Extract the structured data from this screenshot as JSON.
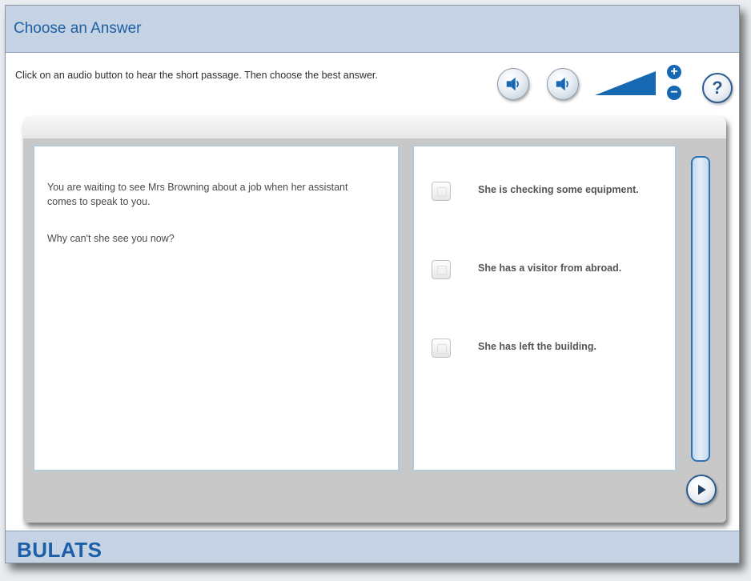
{
  "header": {
    "title": "Choose an Answer"
  },
  "toolbar": {
    "instruction": "Click on an audio button to hear the short passage. Then choose the best answer.",
    "volume_increase_label": "+",
    "volume_decrease_label": "−",
    "help_label": "?"
  },
  "passage": {
    "text": "You are waiting to see Mrs Browning about a job when her assistant comes to speak to you.",
    "question": "Why can't she see you now?"
  },
  "answers": {
    "options": [
      {
        "label": "She is checking some equipment.",
        "checked": false
      },
      {
        "label": "She has a visitor from abroad.",
        "checked": false
      },
      {
        "label": "She has left the building.",
        "checked": false
      }
    ]
  },
  "footer": {
    "brand": "BULATS"
  },
  "colors": {
    "title_bar": "#c5d3e4",
    "accent_blue": "#1668b3",
    "title_text": "#1f5fa4",
    "brand_text": "#1b5fa8"
  },
  "icons": [
    "speaker-icon",
    "volume-level-icon",
    "plus-icon",
    "minus-icon",
    "help-icon",
    "play-arrow-icon"
  ]
}
